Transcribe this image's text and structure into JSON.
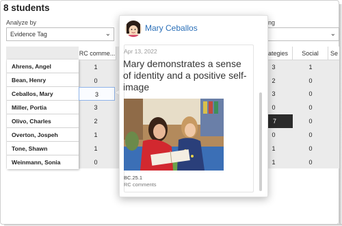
{
  "header": {
    "title": "8 students"
  },
  "filters": {
    "analyze_label": "Analyze by",
    "analyze_value": "Evidence Tag",
    "third_label_partial": "ng"
  },
  "columns": [
    "RC comme...",
    "rategies",
    "Social",
    "Se"
  ],
  "students": [
    {
      "name": "Ahrens, Angel",
      "rc": "1",
      "strategies": "3",
      "social": "1"
    },
    {
      "name": "Bean, Henry",
      "rc": "0",
      "strategies": "2",
      "social": "0"
    },
    {
      "name": "Ceballos, Mary",
      "rc": "3",
      "strategies": "3",
      "social": "0"
    },
    {
      "name": "Miller, Portia",
      "rc": "3",
      "strategies": "0",
      "social": "0"
    },
    {
      "name": "Olivo, Charles",
      "rc": "2",
      "strategies": "7",
      "social": "0"
    },
    {
      "name": "Overton, Jospeh",
      "rc": "1",
      "strategies": "0",
      "social": "0"
    },
    {
      "name": "Tone, Shawn",
      "rc": "1",
      "strategies": "1",
      "social": "0"
    },
    {
      "name": "Weinmann, Sonia",
      "rc": "0",
      "strategies": "1",
      "social": "0"
    }
  ],
  "popup": {
    "student_name": "Mary Ceballos",
    "date": "Apr 13, 2022",
    "observation": "Mary demonstrates a sense of identity and a positive self-image",
    "code": "BC.25.1",
    "category": "RC comments"
  },
  "colors": {
    "link": "#2a6fb8",
    "highlight_border": "#8fb3e8",
    "dark_cell": "#2b2b2b"
  }
}
